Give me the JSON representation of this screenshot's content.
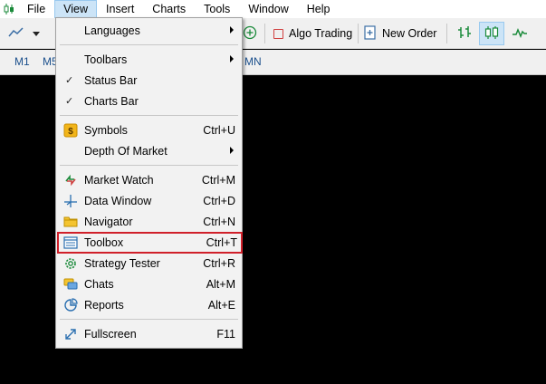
{
  "menubar": {
    "items": [
      "File",
      "View",
      "Insert",
      "Charts",
      "Tools",
      "Window",
      "Help"
    ]
  },
  "toolbar": {
    "algo_trading": "Algo Trading",
    "new_order": "New Order"
  },
  "timeframes": [
    "M1",
    "M5",
    "MN"
  ],
  "view_menu": {
    "items": [
      {
        "label": "Languages",
        "shortcut": "",
        "submenu": true,
        "checked": false,
        "icon": ""
      },
      {
        "label": "Toolbars",
        "shortcut": "",
        "submenu": true,
        "checked": false,
        "icon": ""
      },
      {
        "label": "Status Bar",
        "shortcut": "",
        "submenu": false,
        "checked": true,
        "icon": ""
      },
      {
        "label": "Charts Bar",
        "shortcut": "",
        "submenu": false,
        "checked": true,
        "icon": ""
      },
      {
        "label": "Symbols",
        "shortcut": "Ctrl+U",
        "submenu": false,
        "checked": false,
        "icon": "dollar-icon"
      },
      {
        "label": "Depth Of Market",
        "shortcut": "",
        "submenu": true,
        "checked": false,
        "icon": ""
      },
      {
        "label": "Market Watch",
        "shortcut": "Ctrl+M",
        "submenu": false,
        "checked": false,
        "icon": "market-watch-icon"
      },
      {
        "label": "Data Window",
        "shortcut": "Ctrl+D",
        "submenu": false,
        "checked": false,
        "icon": "crosshair-icon"
      },
      {
        "label": "Navigator",
        "shortcut": "Ctrl+N",
        "submenu": false,
        "checked": false,
        "icon": "folder-icon"
      },
      {
        "label": "Toolbox",
        "shortcut": "Ctrl+T",
        "submenu": false,
        "checked": false,
        "icon": "toolbox-icon",
        "highlighted": true
      },
      {
        "label": "Strategy Tester",
        "shortcut": "Ctrl+R",
        "submenu": false,
        "checked": false,
        "icon": "gear-icon"
      },
      {
        "label": "Chats",
        "shortcut": "Alt+M",
        "submenu": false,
        "checked": false,
        "icon": "chat-icon"
      },
      {
        "label": "Reports",
        "shortcut": "Alt+E",
        "submenu": false,
        "checked": false,
        "icon": "reports-icon"
      },
      {
        "label": "Fullscreen",
        "shortcut": "F11",
        "submenu": false,
        "checked": false,
        "icon": "fullscreen-icon"
      }
    ]
  },
  "colors": {
    "highlight_outline": "#d0202a",
    "active_menu_bg": "#cce4f7",
    "chart_bg": "#000000"
  }
}
